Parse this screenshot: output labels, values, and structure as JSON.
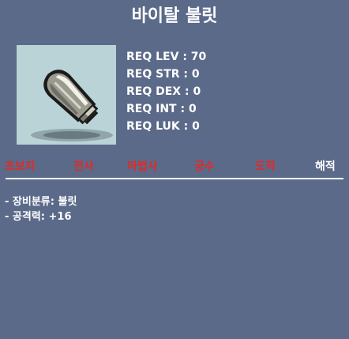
{
  "item": {
    "name": "바이탈 불릿",
    "icon": "bullet-icon"
  },
  "requirements": [
    "REQ LEV : 70",
    "REQ STR : 0",
    "REQ DEX : 0",
    "REQ INT : 0",
    "REQ LUK : 0"
  ],
  "jobs": [
    {
      "label": "초보자",
      "color": "#e02a2a"
    },
    {
      "label": "전사",
      "color": "#e02a2a"
    },
    {
      "label": "마법사",
      "color": "#e02a2a"
    },
    {
      "label": "궁수",
      "color": "#e02a2a"
    },
    {
      "label": "도적",
      "color": "#e02a2a"
    },
    {
      "label": "해적",
      "color": "#ffffff"
    }
  ],
  "description": [
    "- 장비분류: 불릿",
    "- 공격력: +16"
  ],
  "colors": {
    "background": "#5b6a89",
    "icon_background": "#b9d3d6",
    "unavailable_job": "#e02a2a",
    "available_job": "#ffffff"
  }
}
